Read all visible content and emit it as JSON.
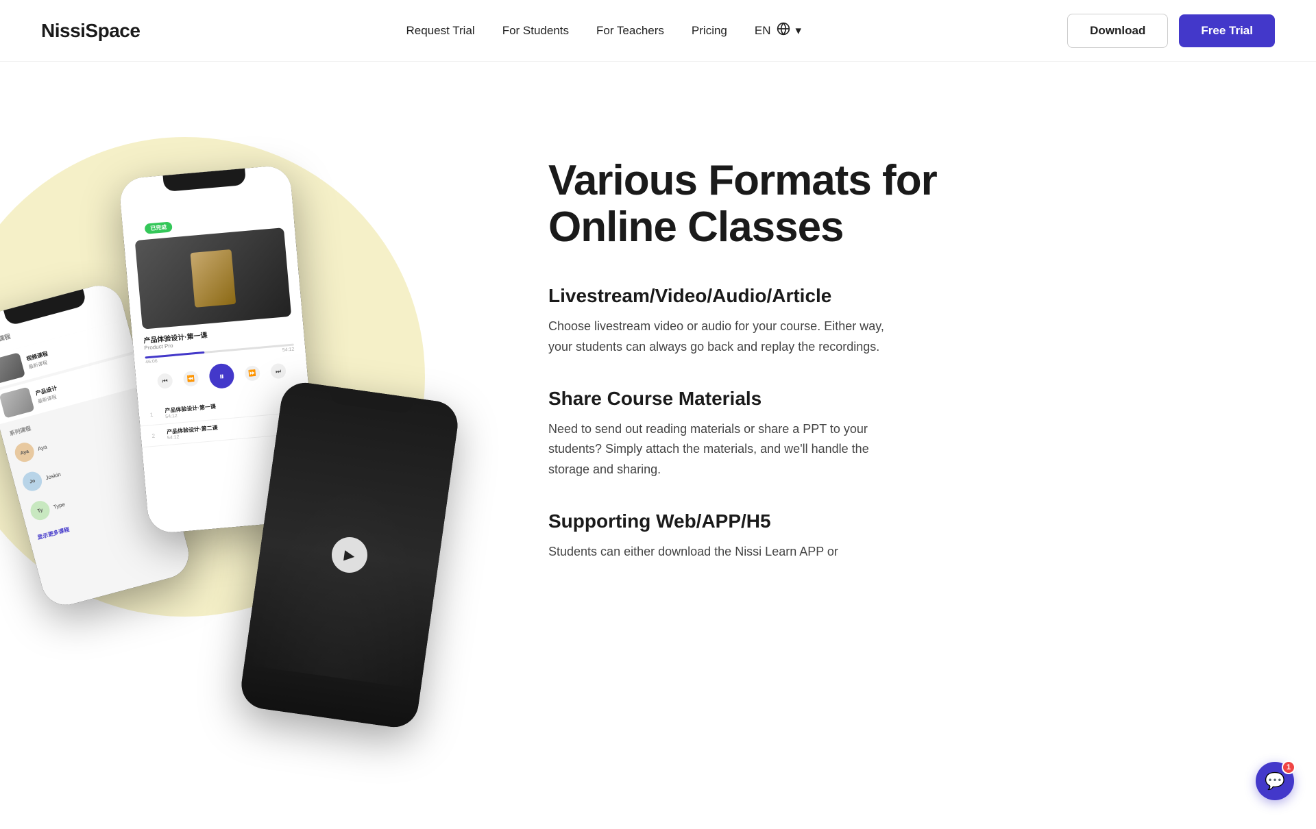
{
  "brand": {
    "name": "NissiSpace"
  },
  "nav": {
    "links": [
      {
        "id": "request-trial",
        "label": "Request Trial"
      },
      {
        "id": "for-students",
        "label": "For Students"
      },
      {
        "id": "for-teachers",
        "label": "For Teachers"
      },
      {
        "id": "pricing",
        "label": "Pricing"
      }
    ],
    "lang": "EN",
    "download_label": "Download",
    "free_trial_label": "Free Trial"
  },
  "hero": {
    "title_line1": "Various Formats for",
    "title_line2": "Online Classes",
    "features": [
      {
        "id": "feature-1",
        "title": "Livestream/Video/Audio/Article",
        "desc": "Choose livestream video or audio for your course. Either way, your students can always go back and replay the recordings."
      },
      {
        "id": "feature-2",
        "title": "Share Course Materials",
        "desc": "Need to send out reading materials or share a PPT to your students? Simply attach the materials, and we'll handle the storage and sharing."
      },
      {
        "id": "feature-3",
        "title": "Supporting Web/APP/H5",
        "desc": "Students can either download the Nissi Learn APP or"
      }
    ]
  },
  "chat_badge": "1",
  "phone_left": {
    "section_title": "视频课程",
    "courses": [
      {
        "title": "视频课程 1",
        "sub": "最新课程",
        "type": "video"
      },
      {
        "title": "产品设计",
        "sub": "最新课程",
        "type": "photo"
      }
    ],
    "avatars": [
      {
        "name": "Aya",
        "label": "Aya"
      },
      {
        "name": "Joskin",
        "label": "Joskin"
      }
    ],
    "more": "显示更多课程"
  },
  "phone_center": {
    "badge": "已完成",
    "cover_label": "产品体验设计·第一课",
    "subtitle": "Product Pro",
    "progress_current": "46:06",
    "progress_total": "54:12",
    "playlist": [
      {
        "num": "1",
        "title": "产品体验设计·第一课",
        "duration": "54:12"
      },
      {
        "num": "2",
        "title": "产品体验设计·第二课",
        "duration": "54:12"
      }
    ]
  },
  "phone_right": {
    "play_icon": "▶"
  }
}
